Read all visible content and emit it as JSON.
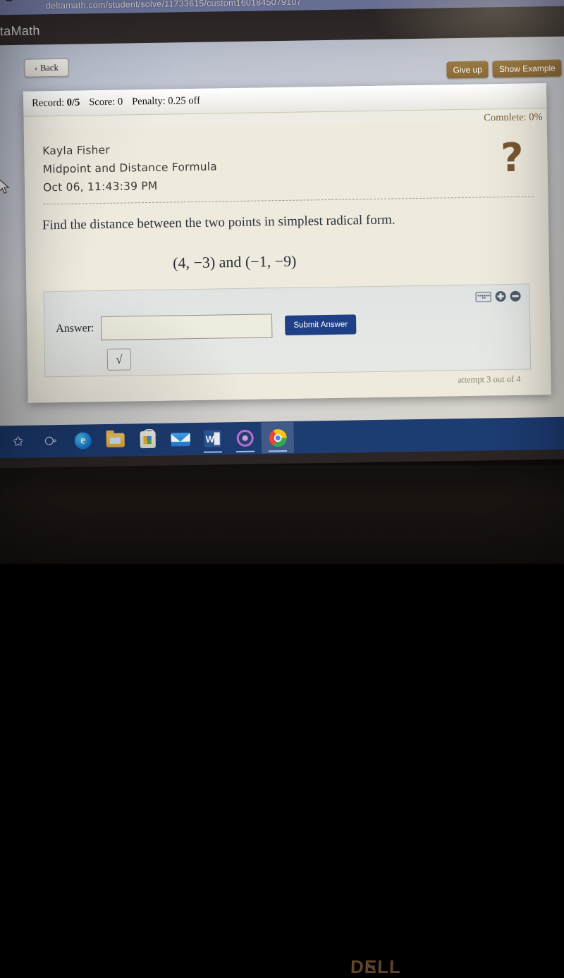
{
  "browser": {
    "url": "deltamath.com/student/solve/11733615/custom1601845079107",
    "tab_title": "ltaMath"
  },
  "toolbar": {
    "back_label": "Back",
    "back_chevron": "‹",
    "give_up_label": "Give up",
    "show_example_label": "Show Example"
  },
  "status_bar": {
    "record_label": "Record:",
    "record_value": "0/5",
    "score_label": "Score:",
    "score_value": "0",
    "penalty_label": "Penalty:",
    "penalty_value": "0.25 off",
    "complete_text": "Complete: 0%"
  },
  "assignment": {
    "student_name": "Kayla Fisher",
    "topic": "Midpoint and Distance Formula",
    "timestamp": "Oct 06, 11:43:39 PM",
    "help_icon": "?",
    "prompt": "Find the distance between the two points in simplest radical form.",
    "points_expression": "(4, −3) and (−1, −9)"
  },
  "answer_panel": {
    "answer_label": "Answer:",
    "answer_value": "",
    "answer_placeholder": "",
    "submit_label": "Submit Answer",
    "radical_symbol": "√",
    "attempt_text": "attempt 3 out of 4"
  },
  "taskbar": {
    "items": [
      {
        "name": "search",
        "glyph": "⌕"
      },
      {
        "name": "task-view",
        "glyph": "⧉"
      },
      {
        "name": "edge",
        "glyph": "e"
      },
      {
        "name": "file-explorer",
        "glyph": ""
      },
      {
        "name": "microsoft-store",
        "glyph": ""
      },
      {
        "name": "mail",
        "glyph": ""
      },
      {
        "name": "word",
        "glyph": "W"
      },
      {
        "name": "cortana-ring",
        "glyph": ""
      },
      {
        "name": "chrome",
        "glyph": ""
      }
    ]
  },
  "hardware": {
    "brand_d": "D",
    "brand_e": "E",
    "brand_ll": "LL"
  },
  "colors": {
    "accent_blue": "#1f3f87",
    "tan_button": "#8a6a38",
    "taskbar": "#1d3c72",
    "help_brown": "#7a5630",
    "complete_brown": "#7a5a30"
  }
}
